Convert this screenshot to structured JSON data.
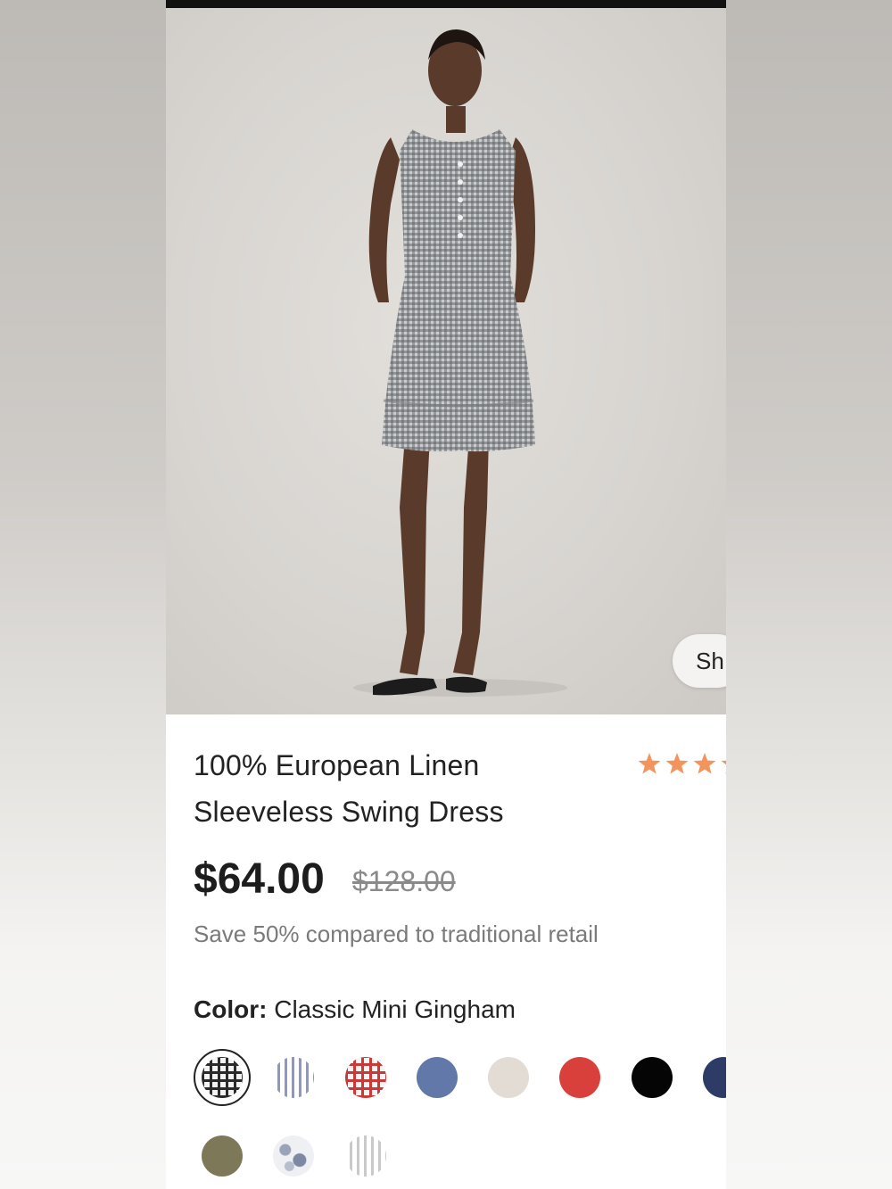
{
  "product": {
    "title_line1": "100% European Linen",
    "title_line2": "Sleeveless Swing Dress",
    "rating_stars": 3.5,
    "price": "$64.00",
    "original_price": "$128.00",
    "savings_text": "Save 50% compared to traditional retail"
  },
  "share_button": {
    "label": "Sh"
  },
  "color_selector": {
    "label": "Color:",
    "selected_color": "Classic Mini Gingham",
    "swatches": [
      {
        "name": "Classic Mini Gingham",
        "pattern": "gingham",
        "color": "#2a2a2a"
      },
      {
        "name": "Blue Stripe",
        "pattern": "stripe",
        "color": "#8e96c2"
      },
      {
        "name": "Red Gingham",
        "pattern": "gingham",
        "color": "#c93a36"
      },
      {
        "name": "Blue",
        "pattern": "solid",
        "color": "#6178a8"
      },
      {
        "name": "Natural",
        "pattern": "solid",
        "color": "#e3dcd5"
      },
      {
        "name": "Red",
        "pattern": "solid",
        "color": "#d9403b"
      },
      {
        "name": "Black",
        "pattern": "solid",
        "color": "#050505"
      },
      {
        "name": "Navy",
        "pattern": "solid",
        "color": "#2c3c66"
      },
      {
        "name": "Olive",
        "pattern": "solid",
        "color": "#7d7958"
      },
      {
        "name": "Floral",
        "pattern": "floral",
        "color": "#9aa3b8"
      },
      {
        "name": "Light Stripe",
        "pattern": "stripe",
        "color": "#c9c9c9"
      }
    ]
  },
  "colors": {
    "star": "#f2945c",
    "price": "#1d1d1d",
    "muted": "#7a7a7a"
  }
}
